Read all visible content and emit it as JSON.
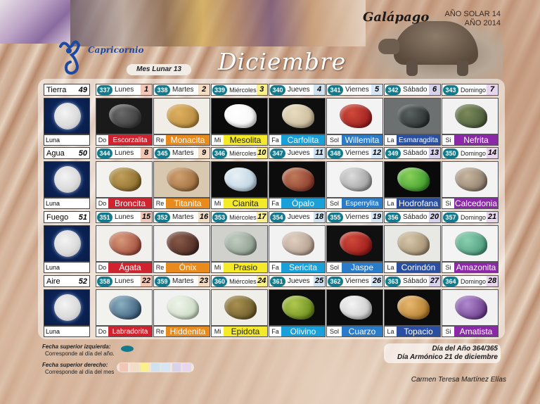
{
  "header": {
    "galapago": "Galápago",
    "anio_solar_line1": "AÑO SOLAR 14",
    "anio_solar_line2": "AÑO 2014",
    "sign": "Capricornio",
    "mes_lunar": "Mes Lunar 13",
    "month": "Diciembre"
  },
  "weeks": [
    {
      "element": "Tierra",
      "week_no": "49",
      "luna": "Luna",
      "days": [
        {
          "badge": "337",
          "name": "Lunes",
          "num": "1",
          "num_color": "#f2c6b4",
          "abbr": "Do",
          "mineral": "Escorzalita",
          "name_bg": "#cf2430",
          "light": false,
          "stone": [
            "#3a3a3a",
            "#6a6a6a"
          ],
          "bg": "#1a1a1a"
        },
        {
          "badge": "338",
          "name": "Martes",
          "num": "2",
          "num_color": "#f4dcc2",
          "abbr": "Re",
          "mineral": "Monacita",
          "name_bg": "#e98a1c",
          "light": false,
          "stone": [
            "#b58a3c",
            "#e0b060"
          ],
          "bg": "#f1eee8"
        },
        {
          "badge": "339",
          "name": "Miércoles",
          "num": "3",
          "num_color": "#fbf188",
          "abbr": "Mi",
          "mineral": "Mesolita",
          "name_bg": "#f5ea2a",
          "light": true,
          "stone": [
            "#f6f6f6",
            "#ffffff"
          ],
          "bg": "#0a0a0a"
        },
        {
          "badge": "340",
          "name": "Jueves",
          "num": "4",
          "num_color": "#cfe2f0",
          "abbr": "Fa",
          "mineral": "Carfolita",
          "name_bg": "#1aa0d8",
          "light": false,
          "stone": [
            "#c8b898",
            "#e8dcc0"
          ],
          "bg": "#0e0e0e"
        },
        {
          "badge": "341",
          "name": "Viernes",
          "num": "5",
          "num_color": "#d7e6f4",
          "abbr": "Sol",
          "mineral": "Willemita",
          "name_bg": "#2a7cc8",
          "light": false,
          "stone": [
            "#9a1e1e",
            "#d04a3a"
          ],
          "bg": "#f3f3f3"
        },
        {
          "badge": "342",
          "name": "Sábado",
          "num": "6",
          "num_color": "#d8d2ec",
          "abbr": "La",
          "mineral": "Esmaragdita",
          "name_bg": "#2a4fa0",
          "light": false,
          "stone": [
            "#2a2e2e",
            "#5a6262"
          ],
          "bg": "#6c7070"
        },
        {
          "badge": "343",
          "name": "Domingo",
          "num": "7",
          "num_color": "#e8d6ee",
          "abbr": "Si",
          "mineral": "Nefrita",
          "name_bg": "#8a28a8",
          "light": false,
          "stone": [
            "#4a5a3a",
            "#7a8a5a"
          ],
          "bg": "#f2f2f2"
        }
      ]
    },
    {
      "element": "Agua",
      "week_no": "50",
      "luna": "Luna",
      "days": [
        {
          "badge": "344",
          "name": "Lunes",
          "num": "8",
          "num_color": "#f2c6b4",
          "abbr": "Do",
          "mineral": "Broncita",
          "name_bg": "#cf2430",
          "light": false,
          "stone": [
            "#8a6a2a",
            "#c0a05a"
          ],
          "bg": "#f4f2ee"
        },
        {
          "badge": "345",
          "name": "Martes",
          "num": "9",
          "num_color": "#f4dcc2",
          "abbr": "Re",
          "mineral": "Titanita",
          "name_bg": "#e98a1c",
          "light": false,
          "stone": [
            "#9a6a3a",
            "#d0a070"
          ],
          "bg": "#d8c8b0"
        },
        {
          "badge": "346",
          "name": "Miércoles",
          "num": "10",
          "num_color": "#fbf188",
          "abbr": "Mi",
          "mineral": "Cianita",
          "name_bg": "#f5ea2a",
          "light": true,
          "stone": [
            "#b8d0e0",
            "#e8f0f6"
          ],
          "bg": "#0c0c0c"
        },
        {
          "badge": "347",
          "name": "Jueves",
          "num": "11",
          "num_color": "#cfe2f0",
          "abbr": "Fa",
          "mineral": "Ópalo",
          "name_bg": "#1aa0d8",
          "light": false,
          "stone": [
            "#8a3a2a",
            "#c07a5a"
          ],
          "bg": "#0c0c0c"
        },
        {
          "badge": "348",
          "name": "Viernes",
          "num": "12",
          "num_color": "#d7e6f4",
          "abbr": "Sol",
          "mineral": "Esperrylita",
          "name_bg": "#2a7cc8",
          "light": false,
          "stone": [
            "#9a9a9a",
            "#dcdcdc"
          ],
          "bg": "#f4f4f4"
        },
        {
          "badge": "349",
          "name": "Sábado",
          "num": "13",
          "num_color": "#d8d2ec",
          "abbr": "La",
          "mineral": "Hodrofana",
          "name_bg": "#2a4fa0",
          "light": false,
          "stone": [
            "#3a9a2a",
            "#8ad05a"
          ],
          "bg": "#0a0a0a"
        },
        {
          "badge": "350",
          "name": "Domingo",
          "num": "14",
          "num_color": "#e8d6ee",
          "abbr": "Si",
          "mineral": "Calcedonia",
          "name_bg": "#8a28a8",
          "light": false,
          "stone": [
            "#8a7a6a",
            "#c8b8a0"
          ],
          "bg": "#f3f3f3"
        }
      ]
    },
    {
      "element": "Fuego",
      "week_no": "51",
      "luna": "Luna",
      "days": [
        {
          "badge": "351",
          "name": "Lunes",
          "num": "15",
          "num_color": "#f2c6b4",
          "abbr": "Do",
          "mineral": "Ágata",
          "name_bg": "#cf2430",
          "light": false,
          "stone": [
            "#a04a3a",
            "#d89a7a"
          ],
          "bg": "#f2f0ec"
        },
        {
          "badge": "352",
          "name": "Martes",
          "num": "16",
          "num_color": "#f4dcc2",
          "abbr": "Re",
          "mineral": "Ónix",
          "name_bg": "#e98a1c",
          "light": false,
          "stone": [
            "#4a2a22",
            "#8a5a4a"
          ],
          "bg": "#f2f0ee"
        },
        {
          "badge": "353",
          "name": "Miércoles",
          "num": "17",
          "num_color": "#fbf188",
          "abbr": "Mi",
          "mineral": "Prasio",
          "name_bg": "#f5ea2a",
          "light": true,
          "stone": [
            "#8a9a8a",
            "#c0ccc0"
          ],
          "bg": "#d0d0cc"
        },
        {
          "badge": "354",
          "name": "Jueves",
          "num": "18",
          "num_color": "#cfe2f0",
          "abbr": "Fa",
          "mineral": "Sericita",
          "name_bg": "#1aa0d8",
          "light": false,
          "stone": [
            "#b09a8a",
            "#e0d0c0"
          ],
          "bg": "#f2f2f2"
        },
        {
          "badge": "355",
          "name": "Viernes",
          "num": "19",
          "num_color": "#d7e6f4",
          "abbr": "Sol",
          "mineral": "Jaspe",
          "name_bg": "#2a7cc8",
          "light": false,
          "stone": [
            "#9a1a1a",
            "#d04a3a"
          ],
          "bg": "#101010"
        },
        {
          "badge": "356",
          "name": "Sábado",
          "num": "20",
          "num_color": "#d8d2ec",
          "abbr": "La",
          "mineral": "Corindón",
          "name_bg": "#2a4fa0",
          "light": false,
          "stone": [
            "#a08a70",
            "#d8c8a8"
          ],
          "bg": "#e8e8e4"
        },
        {
          "badge": "357",
          "name": "Domingo",
          "num": "21",
          "num_color": "#e8d6ee",
          "abbr": "Si",
          "mineral": "Amazonita",
          "name_bg": "#8a28a8",
          "light": false,
          "stone": [
            "#4a9a7a",
            "#8ad0b0"
          ],
          "bg": "#f4f4f4"
        }
      ]
    },
    {
      "element": "Aire",
      "week_no": "52",
      "luna": "Luna",
      "days": [
        {
          "badge": "358",
          "name": "Lunes",
          "num": "22",
          "num_color": "#f2c6b4",
          "abbr": "Do",
          "mineral": "Labradorita",
          "name_bg": "#cf2430",
          "light": false,
          "stone": [
            "#3a5a7a",
            "#8ab0c0"
          ],
          "bg": "#f2f2ee"
        },
        {
          "badge": "359",
          "name": "Martes",
          "num": "23",
          "num_color": "#f4dcc2",
          "abbr": "Re",
          "mineral": "Hiddenita",
          "name_bg": "#e98a1c",
          "light": false,
          "stone": [
            "#c8d8c0",
            "#eef4ea"
          ],
          "bg": "#f2f2f0"
        },
        {
          "badge": "360",
          "name": "Miércoles",
          "num": "24",
          "num_color": "#fbf188",
          "abbr": "Mi",
          "mineral": "Epidota",
          "name_bg": "#f5ea2a",
          "light": true,
          "stone": [
            "#6a5a2a",
            "#a89050"
          ],
          "bg": "#f0eee8"
        },
        {
          "badge": "361",
          "name": "Jueves",
          "num": "25",
          "num_color": "#cfe2f0",
          "abbr": "Fa",
          "mineral": "Olivino",
          "name_bg": "#1aa0d8",
          "light": false,
          "stone": [
            "#6a8a1a",
            "#b0c850"
          ],
          "bg": "#0c0c0c"
        },
        {
          "badge": "362",
          "name": "Viernes",
          "num": "26",
          "num_color": "#d7e6f4",
          "abbr": "Sol",
          "mineral": "Cuarzo",
          "name_bg": "#2a7cc8",
          "light": false,
          "stone": [
            "#c8c8c8",
            "#f4f4f4"
          ],
          "bg": "#0c0c0c"
        },
        {
          "badge": "363",
          "name": "Sábado",
          "num": "27",
          "num_color": "#d8d2ec",
          "abbr": "La",
          "mineral": "Topacio",
          "name_bg": "#2a4fa0",
          "light": false,
          "stone": [
            "#b07a2a",
            "#e8b870"
          ],
          "bg": "#0c0c0c"
        },
        {
          "badge": "364",
          "name": "Domingo",
          "num": "28",
          "num_color": "#e8d6ee",
          "abbr": "Si",
          "mineral": "Amatista",
          "name_bg": "#8a28a8",
          "light": false,
          "stone": [
            "#6a3a8a",
            "#b08ad0"
          ],
          "bg": "#f2f2f2"
        }
      ]
    }
  ],
  "legend": {
    "top_left_title": "Fecha superior izquierda:",
    "top_left_desc": "Corresponde al día del año.",
    "top_right_title": "Fecha superior derecho:",
    "top_right_desc": "Corresponde al día del mes",
    "swatch_colors": [
      "#f2c6b4",
      "#f4dcc2",
      "#fbf188",
      "#cfe2f0",
      "#d7e6f4",
      "#d8d2ec",
      "#e8d6ee"
    ]
  },
  "footer": {
    "dia_anio": "Día del Año 364/365",
    "dia_armonico": "Día Armónico 21 de diciembre",
    "author": "Carmen Teresa Martínez Elías"
  }
}
